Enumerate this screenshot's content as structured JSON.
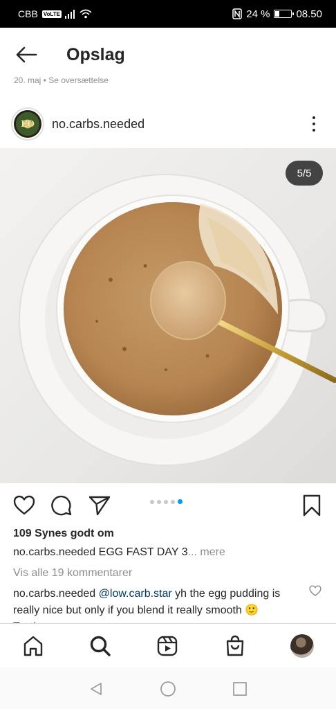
{
  "status_bar": {
    "carrier": "CBB",
    "volte": "VoLTE",
    "battery_percent": "24 %",
    "battery_level": 0.24,
    "time": "08.50"
  },
  "header": {
    "title": "Opslag",
    "partial_line": "20. maj • Se oversættelse"
  },
  "post": {
    "username": "no.carbs.needed",
    "avatar_text": "EO",
    "image_counter": "5/5",
    "carousel_count": 5,
    "carousel_active_index": 4,
    "likes": "109 Synes godt om",
    "caption_user": "no.carbs.needed",
    "caption_text": " EGG FAST DAY 3",
    "caption_more": "... mere",
    "view_all_comments": "Vis alle 19 kommentarer",
    "comment": {
      "user": "no.carbs.needed",
      "mention": "@low.carb.star",
      "text": " yh the egg pudding is really nice but only if you blend it really smooth 🙂 Tasting"
    }
  },
  "icons": {
    "back": "back-arrow-icon",
    "more": "more-options-icon",
    "like": "heart-icon",
    "comment": "comment-icon",
    "share": "share-icon",
    "save": "bookmark-icon",
    "home": "home-icon",
    "search": "search-icon",
    "reels": "reels-icon",
    "shop": "shop-icon"
  },
  "colors": {
    "accent": "#0095f6",
    "text": "#262626",
    "muted": "#8e8e8e",
    "mention": "#00376b"
  }
}
